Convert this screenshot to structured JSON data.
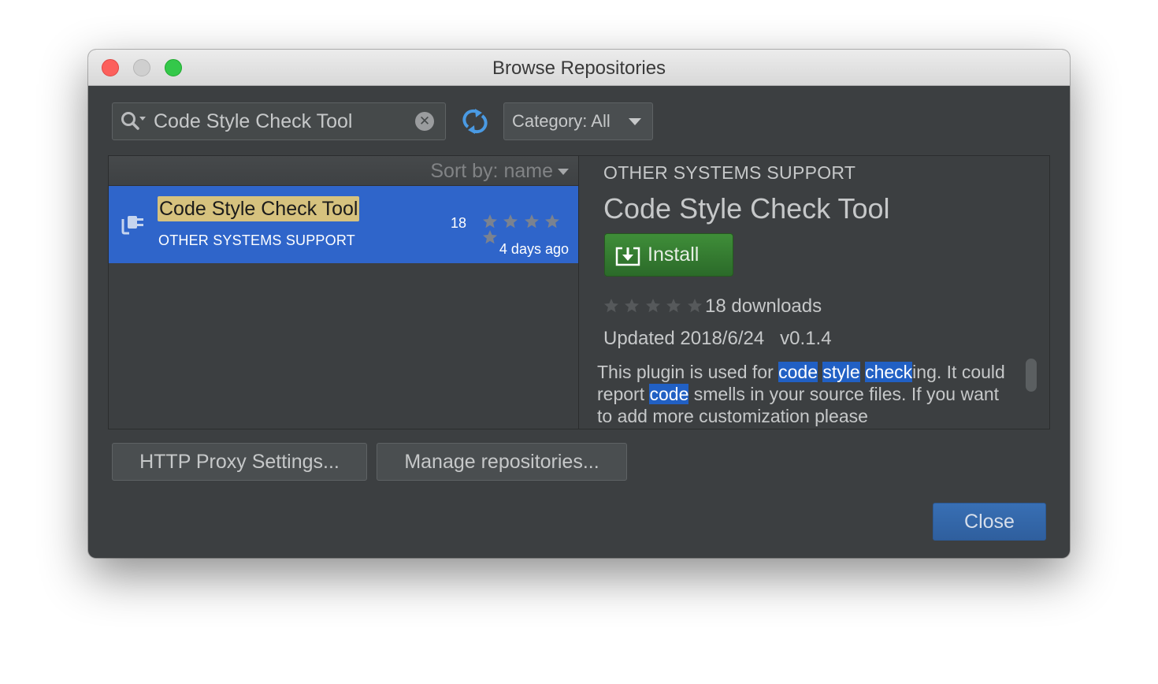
{
  "window": {
    "title": "Browse Repositories"
  },
  "search": {
    "value": "Code Style Check Tool"
  },
  "toolbar": {
    "category_label": "Category: All"
  },
  "list": {
    "sort_label": "Sort by: name",
    "items": [
      {
        "name": "Code Style Check Tool",
        "category": "OTHER SYSTEMS SUPPORT",
        "downloads": "18",
        "date": "4 days ago",
        "rating": 0
      }
    ]
  },
  "detail": {
    "category": "OTHER SYSTEMS SUPPORT",
    "name": "Code Style Check Tool",
    "install_label": "Install",
    "downloads": "18 downloads",
    "updated": "Updated 2018/6/24   v0.1.4",
    "description": {
      "p1": "This plugin is used for ",
      "h1": "code",
      "p2": " ",
      "h2": "style",
      "p3": " ",
      "h3": "check",
      "p4": "ing. It could report ",
      "h4": "code",
      "p5": " smells in your source files. If you want to add more customization please"
    },
    "rating": 0
  },
  "footer": {
    "proxy_label": "HTTP Proxy Settings...",
    "repos_label": "Manage repositories...",
    "close_label": "Close"
  },
  "colors": {
    "window_bg": "#3c3f41",
    "selection": "#2f65ca",
    "highlight": "#d6c27e",
    "install_green": "#3f8e39",
    "close_blue": "#386fb4"
  }
}
